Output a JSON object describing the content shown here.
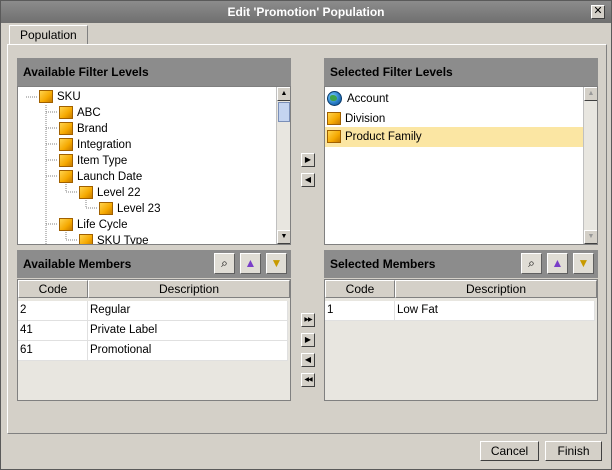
{
  "window": {
    "title": "Edit 'Promotion' Population"
  },
  "tabs": [
    {
      "label": "Population"
    }
  ],
  "available_filter_levels": {
    "header": "Available Filter Levels",
    "tree": [
      {
        "label": "SKU",
        "depth": 0
      },
      {
        "label": "ABC",
        "depth": 1
      },
      {
        "label": "Brand",
        "depth": 1
      },
      {
        "label": "Integration",
        "depth": 1
      },
      {
        "label": "Item Type",
        "depth": 1
      },
      {
        "label": "Launch Date",
        "depth": 1
      },
      {
        "label": "Level 22",
        "depth": 2
      },
      {
        "label": "Level 23",
        "depth": 3
      },
      {
        "label": "Life Cycle",
        "depth": 1
      },
      {
        "label": "SKU Type",
        "depth": 2
      }
    ]
  },
  "selected_filter_levels": {
    "header": "Selected Filter Levels",
    "items": [
      {
        "label": "Account",
        "icon": "globe-icon"
      },
      {
        "label": "Division",
        "icon": "folder-icon"
      },
      {
        "label": "Product Family",
        "icon": "folder-icon",
        "selected": true
      }
    ]
  },
  "available_members": {
    "header": "Available Members",
    "columns": [
      "Code",
      "Description"
    ],
    "rows": [
      [
        "2",
        "Regular"
      ],
      [
        "41",
        "Private Label"
      ],
      [
        "61",
        "Promotional"
      ]
    ]
  },
  "selected_members": {
    "header": "Selected Members",
    "columns": [
      "Code",
      "Description"
    ],
    "rows": [
      [
        "1",
        "Low Fat"
      ]
    ]
  },
  "buttons": {
    "cancel": "Cancel",
    "finish": "Finish"
  },
  "glyphs": {
    "close": "✕",
    "move_right": "▶",
    "move_left": "◀",
    "move_all_right": "▶▶",
    "move_all_left": "◀◀",
    "scroll_up": "▲",
    "scroll_down": "▼",
    "search": "⌕",
    "hierarchy": "▲",
    "filter": "▼"
  },
  "colors": {
    "selection": "#fbe6a3",
    "header": "#8c8c8c",
    "dialog": "#d4d0c8"
  }
}
